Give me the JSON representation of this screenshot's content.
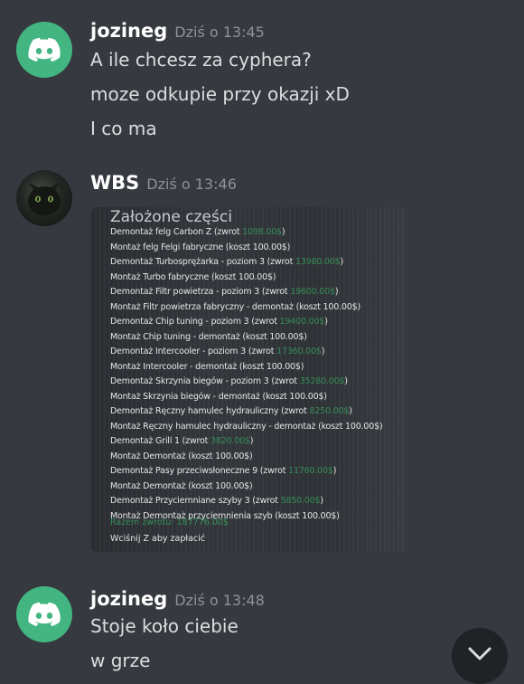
{
  "messages": [
    {
      "username": "jozineg",
      "timestamp": "Dziś o 13:45",
      "avatar_icon": "discord-logo-icon",
      "lines": [
        "A ile chcesz za cyphera?",
        "moze odkupie przy okazji xD",
        "I co ma"
      ]
    },
    {
      "username": "WBS",
      "timestamp": "Dziś o 13:46",
      "avatar_icon": "dragon-avatar",
      "image": {
        "title": "Założone części",
        "rows": [
          {
            "text": "Demontaż felg Carbon Z (zwrot ",
            "green": "1098.00$",
            "tail": ")"
          },
          {
            "text": "Montaż felg Felgi fabryczne (koszt 100.00$)",
            "green": "",
            "tail": ""
          },
          {
            "text": "Demontaż Turbosprężarka - poziom 3 (zwrot ",
            "green": "13980.00$",
            "tail": ")"
          },
          {
            "text": "Montaż Turbo fabryczne (koszt 100.00$)",
            "green": "",
            "tail": ""
          },
          {
            "text": "Demontaż Filtr powietrza - poziom 3 (zwrot ",
            "green": "19600.00$",
            "tail": ")"
          },
          {
            "text": "Montaż Filtr powietrza fabryczny - demontaż (koszt 100.00$)",
            "green": "",
            "tail": ""
          },
          {
            "text": "Demontaż Chip tuning - poziom 3 (zwrot ",
            "green": "19400.00$",
            "tail": ")"
          },
          {
            "text": "Montaż Chip tuning - demontaż (koszt 100.00$)",
            "green": "",
            "tail": ""
          },
          {
            "text": "Demontaż Intercooler - poziom 3 (zwrot ",
            "green": "17360.00$",
            "tail": ")"
          },
          {
            "text": "Montaż Intercooler - demontaż (koszt 100.00$)",
            "green": "",
            "tail": ""
          },
          {
            "text": "Demontaż Skrzynia biegów - poziom 3 (zwrot ",
            "green": "35280.00$",
            "tail": ")"
          },
          {
            "text": "Montaż Skrzynia biegów - demontaż (koszt 100.00$)",
            "green": "",
            "tail": ""
          },
          {
            "text": "Demontaż Ręczny hamulec hydrauliczny (zwrot ",
            "green": "8250.00$",
            "tail": ")"
          },
          {
            "text": "Montaż Ręczny hamulec hydrauliczny - demontaż (koszt 100.00$)",
            "green": "",
            "tail": ""
          },
          {
            "text": "Demontaż Grill 1 (zwrot ",
            "green": "3820.00$",
            "tail": ")"
          },
          {
            "text": "Montaż Demontaż (koszt 100.00$)",
            "green": "",
            "tail": ""
          },
          {
            "text": "Demontaż Pasy przeciwsłoneczne 9 (zwrot ",
            "green": "11760.00$",
            "tail": ")"
          },
          {
            "text": "Montaż Demontaż (koszt 100.00$)",
            "green": "",
            "tail": ""
          },
          {
            "text": "Demontaż Przyciemniane szyby 3 (zwrot ",
            "green": "5850.00$",
            "tail": ")"
          },
          {
            "text": "Montaż Demontaż przyciemnienia szyb (koszt 100.00$)",
            "green": "",
            "tail": ""
          }
        ],
        "total": "Razem zwrotu: 187776.00$",
        "pay_hint": "Wciśnij Z aby zapłacić"
      }
    },
    {
      "username": "jozineg",
      "timestamp": "Dziś o 13:48",
      "avatar_icon": "discord-logo-icon",
      "lines": [
        "Stoje koło ciebie",
        "w grze"
      ]
    }
  ],
  "scroll_button_icon": "chevron-down-icon",
  "colors": {
    "background": "#36393f",
    "username": "#ffffff",
    "timestamp": "#8e9297",
    "text": "#dcddde",
    "discord_avatar": "#43b581",
    "zwrot_green": "#3bd16f"
  }
}
